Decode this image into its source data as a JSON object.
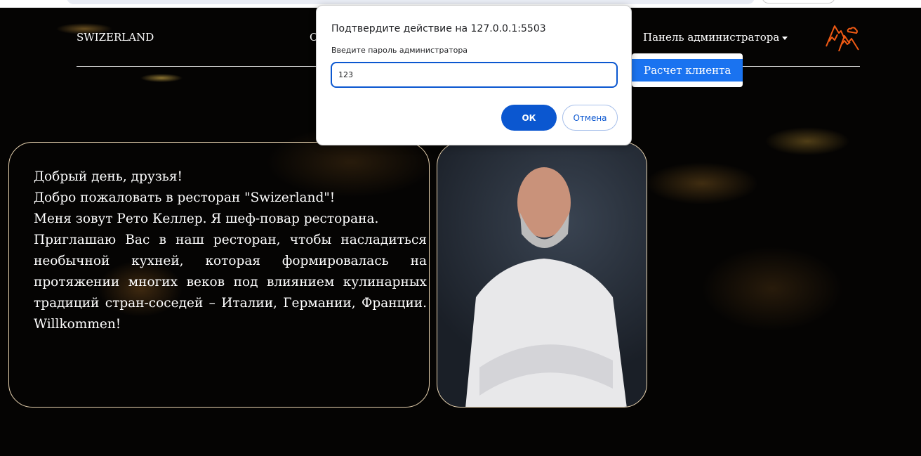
{
  "nav": {
    "brand": "SWIZERLAND",
    "item_partial": "О",
    "admin_menu": "Панель администратора",
    "dropdown_items": [
      "Расчет клиента"
    ]
  },
  "welcome": {
    "lines": [
      "Добрый день, друзья!",
      "Добро пожаловать в ресторан \"Swizerland\"!",
      "Меня зовут Рето Келлер. Я шеф-повар ресторана."
    ],
    "paragraph": "Приглашаю Вас в наш ресторан, чтобы насладиться необычной кухней, которая формировалась на протяжении многих веков под влиянием кулинарных традиций стран-соседей – Италии, Германии, Франции. Willkommen!"
  },
  "dialog": {
    "title": "Подтвердите действие на 127.0.0.1:5503",
    "message": "Введите пароль администратора",
    "value": "123",
    "ok": "ОК",
    "cancel": "Отмена"
  },
  "colors": {
    "accent": "#1a73f0",
    "logo": "#f05a14",
    "dialog_primary": "#0b57d0"
  }
}
